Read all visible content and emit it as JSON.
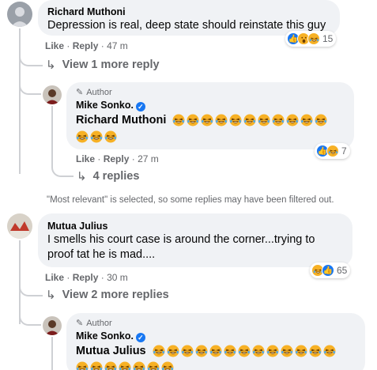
{
  "comment1": {
    "author": "Richard Muthoni",
    "text": "Depression is real, deep state should reinstate this guy",
    "like": "Like",
    "reply": "Reply",
    "time": "47 m",
    "reaction_count": "15",
    "view_more": "View 1 more reply"
  },
  "reply1": {
    "author_tag": "Author",
    "author": "Mike Sonko.",
    "mention": "Richard Muthoni",
    "like": "Like",
    "reply": "Reply",
    "time": "27 m",
    "reaction_count": "7",
    "replies": "4 replies"
  },
  "notice": "\"Most relevant\" is selected, so some replies may have been filtered out.",
  "comment2": {
    "author": "Mutua Julius",
    "text_line1": "I smells his court case is around the corner...trying to",
    "text_line2": "proof tat he is mad....",
    "like": "Like",
    "reply": "Reply",
    "time": "30 m",
    "reaction_count": "65",
    "view_more": "View 2 more replies"
  },
  "reply2": {
    "author_tag": "Author",
    "author": "Mike Sonko.",
    "mention": "Mutua Julius"
  },
  "separator": "·",
  "icons": {
    "reply_arrow": "reply-arrow-icon",
    "pencil": "pencil-icon",
    "verified": "verified-badge-icon",
    "laugh": "laughing-emoji-icon"
  },
  "colors": {
    "bubble": "#f0f2f5",
    "secondary_text": "#65676b",
    "like_blue": "#1877f2",
    "emoji_yellow": "#f7b125"
  }
}
